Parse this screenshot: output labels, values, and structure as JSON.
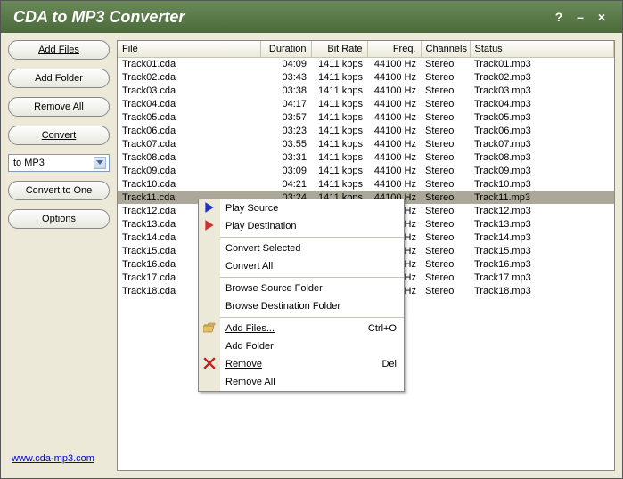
{
  "title": "CDA to MP3 Converter",
  "titlebar": {
    "help": "?",
    "min": "–",
    "close": "×"
  },
  "sidebar": {
    "add_files": "Add Files",
    "add_folder": "Add Folder",
    "remove_all": "Remove All",
    "convert": "Convert",
    "format_select": "to MP3",
    "convert_one": "Convert to One",
    "options": "Options"
  },
  "footer_link": "www.cda-mp3.com",
  "columns": {
    "file": "File",
    "duration": "Duration",
    "bitrate": "Bit Rate",
    "freq": "Freq.",
    "channels": "Channels",
    "status": "Status"
  },
  "rows": [
    {
      "file": "Track01.cda",
      "dur": "04:09",
      "br": "1411 kbps",
      "freq": "44100 Hz",
      "ch": "Stereo",
      "status": "Track01.mp3"
    },
    {
      "file": "Track02.cda",
      "dur": "03:43",
      "br": "1411 kbps",
      "freq": "44100 Hz",
      "ch": "Stereo",
      "status": "Track02.mp3"
    },
    {
      "file": "Track03.cda",
      "dur": "03:38",
      "br": "1411 kbps",
      "freq": "44100 Hz",
      "ch": "Stereo",
      "status": "Track03.mp3"
    },
    {
      "file": "Track04.cda",
      "dur": "04:17",
      "br": "1411 kbps",
      "freq": "44100 Hz",
      "ch": "Stereo",
      "status": "Track04.mp3"
    },
    {
      "file": "Track05.cda",
      "dur": "03:57",
      "br": "1411 kbps",
      "freq": "44100 Hz",
      "ch": "Stereo",
      "status": "Track05.mp3"
    },
    {
      "file": "Track06.cda",
      "dur": "03:23",
      "br": "1411 kbps",
      "freq": "44100 Hz",
      "ch": "Stereo",
      "status": "Track06.mp3"
    },
    {
      "file": "Track07.cda",
      "dur": "03:55",
      "br": "1411 kbps",
      "freq": "44100 Hz",
      "ch": "Stereo",
      "status": "Track07.mp3"
    },
    {
      "file": "Track08.cda",
      "dur": "03:31",
      "br": "1411 kbps",
      "freq": "44100 Hz",
      "ch": "Stereo",
      "status": "Track08.mp3"
    },
    {
      "file": "Track09.cda",
      "dur": "03:09",
      "br": "1411 kbps",
      "freq": "44100 Hz",
      "ch": "Stereo",
      "status": "Track09.mp3"
    },
    {
      "file": "Track10.cda",
      "dur": "04:21",
      "br": "1411 kbps",
      "freq": "44100 Hz",
      "ch": "Stereo",
      "status": "Track10.mp3"
    },
    {
      "file": "Track11.cda",
      "dur": "03:24",
      "br": "1411 kbps",
      "freq": "44100 Hz",
      "ch": "Stereo",
      "status": "Track11.mp3",
      "sel": true
    },
    {
      "file": "Track12.cda",
      "dur": "",
      "br": "",
      "freq": "4100 Hz",
      "ch": "Stereo",
      "status": "Track12.mp3"
    },
    {
      "file": "Track13.cda",
      "dur": "",
      "br": "",
      "freq": "4100 Hz",
      "ch": "Stereo",
      "status": "Track13.mp3"
    },
    {
      "file": "Track14.cda",
      "dur": "",
      "br": "",
      "freq": "4100 Hz",
      "ch": "Stereo",
      "status": "Track14.mp3"
    },
    {
      "file": "Track15.cda",
      "dur": "",
      "br": "",
      "freq": "4100 Hz",
      "ch": "Stereo",
      "status": "Track15.mp3"
    },
    {
      "file": "Track16.cda",
      "dur": "",
      "br": "",
      "freq": "4100 Hz",
      "ch": "Stereo",
      "status": "Track16.mp3"
    },
    {
      "file": "Track17.cda",
      "dur": "",
      "br": "",
      "freq": "4100 Hz",
      "ch": "Stereo",
      "status": "Track17.mp3"
    },
    {
      "file": "Track18.cda",
      "dur": "",
      "br": "",
      "freq": "4100 Hz",
      "ch": "Stereo",
      "status": "Track18.mp3"
    }
  ],
  "menu": {
    "play_source": "Play Source",
    "play_dest": "Play Destination",
    "convert_sel": "Convert Selected",
    "convert_all": "Convert All",
    "browse_src": "Browse Source Folder",
    "browse_dst": "Browse Destination Folder",
    "add_files": "Add Files...",
    "add_files_key": "Ctrl+O",
    "add_folder": "Add Folder",
    "remove": "Remove",
    "remove_key": "Del",
    "remove_all": "Remove All"
  }
}
